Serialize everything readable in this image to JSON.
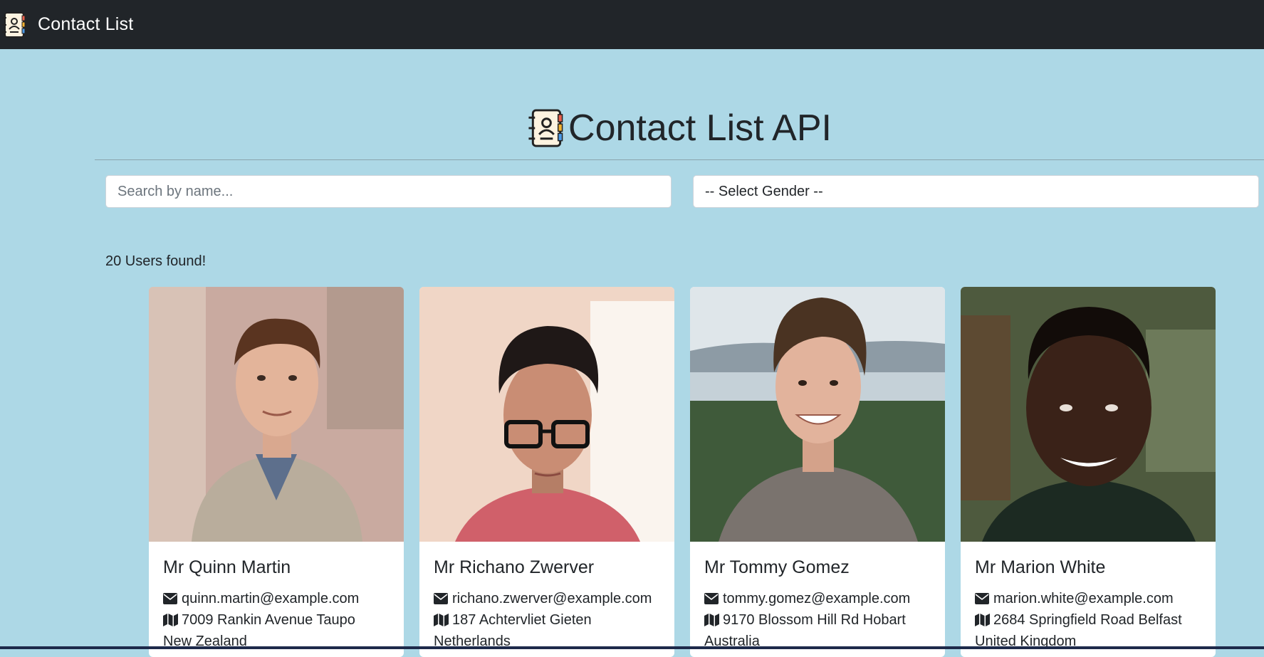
{
  "navbar": {
    "title": "Contact List",
    "logo_icon": "address-book-icon"
  },
  "header": {
    "title": "Contact List API",
    "logo_icon": "address-book-icon"
  },
  "filters": {
    "search_placeholder": "Search by name...",
    "search_value": "",
    "gender_selected": "-- Select Gender --"
  },
  "results": {
    "count_text": "20 Users found!"
  },
  "users": [
    {
      "name": "Mr Quinn Martin",
      "email": "quinn.martin@example.com",
      "address_line1": "7009 Rankin Avenue Taupo",
      "address_line2": "New Zealand",
      "photo_colors": {
        "bg": "#c9aaa0",
        "skin": "#e3b49a",
        "hair": "#5a3420",
        "shirt": "#b9ad9c"
      }
    },
    {
      "name": "Mr Richano Zwerver",
      "email": "richano.zwerver@example.com",
      "address_line1": "187 Achtervliet Gieten",
      "address_line2": "Netherlands",
      "photo_colors": {
        "bg": "#f0d6c6",
        "skin": "#c98d74",
        "hair": "#1f1817",
        "shirt": "#d0606a"
      }
    },
    {
      "name": "Mr Tommy Gomez",
      "email": "tommy.gomez@example.com",
      "address_line1": "9170 Blossom Hill Rd Hobart",
      "address_line2": "Australia",
      "photo_colors": {
        "bg": "#9fb0b8",
        "skin": "#e2b39c",
        "hair": "#4a3322",
        "shirt": "#7a736e"
      }
    },
    {
      "name": "Mr Marion White",
      "email": "marion.white@example.com",
      "address_line1": "2684 Springfield Road Belfast",
      "address_line2": "United Kingdom",
      "photo_colors": {
        "bg": "#4e5a3e",
        "skin": "#3a2218",
        "hair": "#120c09",
        "shirt": "#1c2a22"
      }
    }
  ],
  "icons": {
    "email": "envelope-icon",
    "address": "map-icon"
  }
}
